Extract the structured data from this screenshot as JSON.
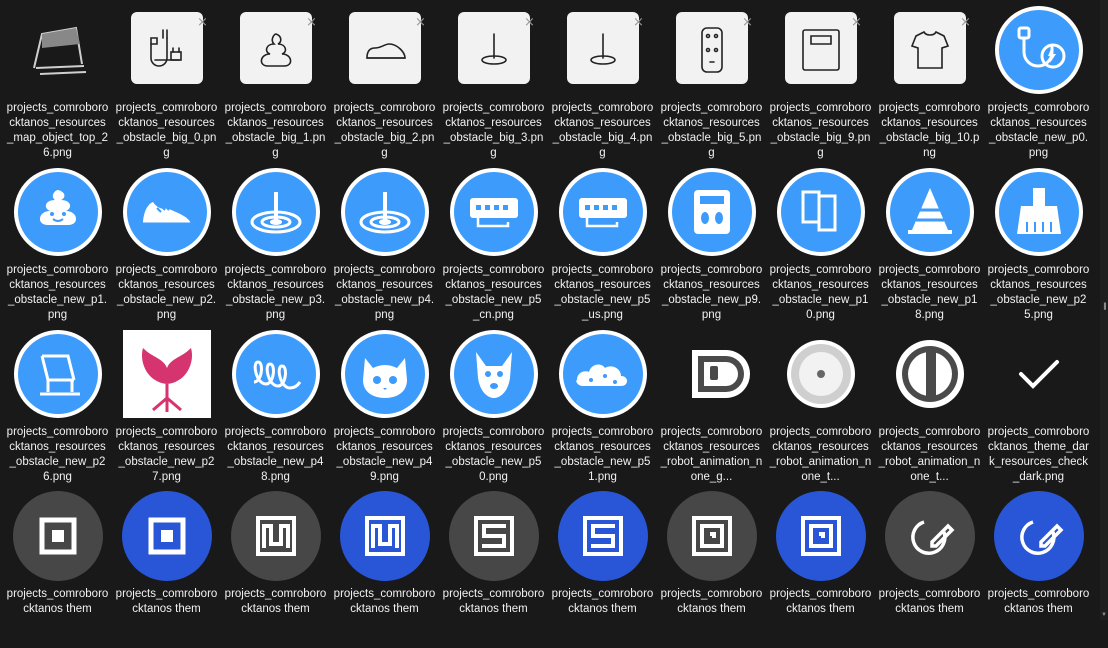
{
  "files": [
    {
      "label": "projects_comroborocktanos_resources_map_object_top_26.png",
      "icon": "chair-icon"
    },
    {
      "label": "projects_comroborocktanos_resources_obstacle_big_0.png",
      "icon": "cable-icon"
    },
    {
      "label": "projects_comroborocktanos_resources_obstacle_big_1.png",
      "icon": "poop-icon"
    },
    {
      "label": "projects_comroborocktanos_resources_obstacle_big_2.png",
      "icon": "shoe-icon"
    },
    {
      "label": "projects_comroborocktanos_resources_obstacle_big_3.png",
      "icon": "base-icon"
    },
    {
      "label": "projects_comroborocktanos_resources_obstacle_big_4.png",
      "icon": "base-icon"
    },
    {
      "label": "projects_comroborocktanos_resources_obstacle_big_5.png",
      "icon": "power-strip-icon"
    },
    {
      "label": "projects_comroborocktanos_resources_obstacle_big_9.png",
      "icon": "scale-icon"
    },
    {
      "label": "projects_comroborocktanos_resources_obstacle_big_10.png",
      "icon": "shirt-icon"
    },
    {
      "label": "projects_comroborocktanos_resources_obstacle_new_p0.png",
      "icon": "cable-icon"
    },
    {
      "label": "projects_comroborocktanos_resources_obstacle_new_p1.png",
      "icon": "poop-icon"
    },
    {
      "label": "projects_comroborocktanos_resources_obstacle_new_p2.png",
      "icon": "sneaker-icon"
    },
    {
      "label": "projects_comroborocktanos_resources_obstacle_new_p3.png",
      "icon": "base-icon"
    },
    {
      "label": "projects_comroborocktanos_resources_obstacle_new_p4.png",
      "icon": "base-icon"
    },
    {
      "label": "projects_comroborocktanos_resources_obstacle_new_p5_cn.png",
      "icon": "power-strip-icon"
    },
    {
      "label": "projects_comroborocktanos_resources_obstacle_new_p5_us.png",
      "icon": "power-strip-icon"
    },
    {
      "label": "projects_comroborocktanos_resources_obstacle_new_p9.png",
      "icon": "scale-icon"
    },
    {
      "label": "projects_comroborocktanos_resources_obstacle_new_p10.png",
      "icon": "book-icon"
    },
    {
      "label": "projects_comroborocktanos_resources_obstacle_new_p18.png",
      "icon": "cone-icon"
    },
    {
      "label": "projects_comroborocktanos_resources_obstacle_new_p25.png",
      "icon": "dustpan-icon"
    },
    {
      "label": "projects_comroborocktanos_resources_obstacle_new_p26.png",
      "icon": "chair-icon"
    },
    {
      "label": "projects_comroborocktanos_resources_obstacle_new_p27.png",
      "icon": "swan-chair-icon"
    },
    {
      "label": "projects_comroborocktanos_resources_obstacle_new_p48.png",
      "icon": "loops-icon"
    },
    {
      "label": "projects_comroborocktanos_resources_obstacle_new_p49.png",
      "icon": "cat-icon"
    },
    {
      "label": "projects_comroborocktanos_resources_obstacle_new_p50.png",
      "icon": "dog-icon"
    },
    {
      "label": "projects_comroborocktanos_resources_obstacle_new_p51.png",
      "icon": "cloud-icon"
    },
    {
      "label": "projects_comroborocktanos_resources_robot_animation_none_g...",
      "icon": "robot-side-icon"
    },
    {
      "label": "projects_comroborocktanos_resources_robot_animation_none_t...",
      "icon": "robot-top-icon"
    },
    {
      "label": "projects_comroborocktanos_resources_robot_animation_none_t...",
      "icon": "robot-top-side-icon"
    },
    {
      "label": "projects_comroborocktanos_theme_dark_resources_check_dark.png",
      "icon": "check-icon"
    },
    {
      "label": "projects_comroborocktanos them",
      "icon": "square-mode-icon"
    },
    {
      "label": "projects_comroborocktanos them",
      "icon": "square-mode-icon"
    },
    {
      "label": "projects_comroborocktanos them",
      "icon": "zigzag-mode-icon"
    },
    {
      "label": "projects_comroborocktanos them",
      "icon": "zigzag-mode-icon"
    },
    {
      "label": "projects_comroborocktanos them",
      "icon": "s-mode-icon"
    },
    {
      "label": "projects_comroborocktanos them",
      "icon": "s-mode-icon"
    },
    {
      "label": "projects_comroborocktanos them",
      "icon": "double-square-mode-icon"
    },
    {
      "label": "projects_comroborocktanos them",
      "icon": "double-square-mode-icon"
    },
    {
      "label": "projects_comroborocktanos them",
      "icon": "edit-mode-icon"
    },
    {
      "label": "projects_comroborocktanos them",
      "icon": "edit-mode-icon"
    }
  ],
  "colors": {
    "background": "#191919",
    "blue": "#3d9bfb",
    "royal_blue": "#2856d6",
    "dark_gray": "#474747",
    "card": "#f2f2f2",
    "pink": "#d6346e"
  }
}
